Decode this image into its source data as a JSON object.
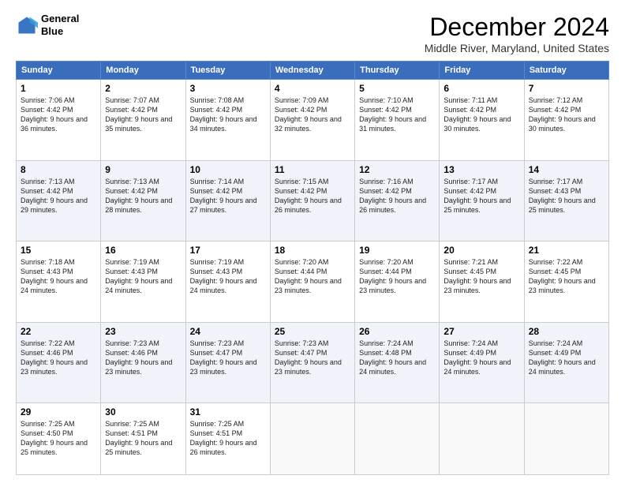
{
  "header": {
    "logo_line1": "General",
    "logo_line2": "Blue",
    "title": "December 2024",
    "subtitle": "Middle River, Maryland, United States"
  },
  "days_of_week": [
    "Sunday",
    "Monday",
    "Tuesday",
    "Wednesday",
    "Thursday",
    "Friday",
    "Saturday"
  ],
  "weeks": [
    [
      {
        "day": "1",
        "sunrise": "7:06 AM",
        "sunset": "4:42 PM",
        "daylight": "9 hours and 36 minutes."
      },
      {
        "day": "2",
        "sunrise": "7:07 AM",
        "sunset": "4:42 PM",
        "daylight": "9 hours and 35 minutes."
      },
      {
        "day": "3",
        "sunrise": "7:08 AM",
        "sunset": "4:42 PM",
        "daylight": "9 hours and 34 minutes."
      },
      {
        "day": "4",
        "sunrise": "7:09 AM",
        "sunset": "4:42 PM",
        "daylight": "9 hours and 32 minutes."
      },
      {
        "day": "5",
        "sunrise": "7:10 AM",
        "sunset": "4:42 PM",
        "daylight": "9 hours and 31 minutes."
      },
      {
        "day": "6",
        "sunrise": "7:11 AM",
        "sunset": "4:42 PM",
        "daylight": "9 hours and 30 minutes."
      },
      {
        "day": "7",
        "sunrise": "7:12 AM",
        "sunset": "4:42 PM",
        "daylight": "9 hours and 30 minutes."
      }
    ],
    [
      {
        "day": "8",
        "sunrise": "7:13 AM",
        "sunset": "4:42 PM",
        "daylight": "9 hours and 29 minutes."
      },
      {
        "day": "9",
        "sunrise": "7:13 AM",
        "sunset": "4:42 PM",
        "daylight": "9 hours and 28 minutes."
      },
      {
        "day": "10",
        "sunrise": "7:14 AM",
        "sunset": "4:42 PM",
        "daylight": "9 hours and 27 minutes."
      },
      {
        "day": "11",
        "sunrise": "7:15 AM",
        "sunset": "4:42 PM",
        "daylight": "9 hours and 26 minutes."
      },
      {
        "day": "12",
        "sunrise": "7:16 AM",
        "sunset": "4:42 PM",
        "daylight": "9 hours and 26 minutes."
      },
      {
        "day": "13",
        "sunrise": "7:17 AM",
        "sunset": "4:42 PM",
        "daylight": "9 hours and 25 minutes."
      },
      {
        "day": "14",
        "sunrise": "7:17 AM",
        "sunset": "4:43 PM",
        "daylight": "9 hours and 25 minutes."
      }
    ],
    [
      {
        "day": "15",
        "sunrise": "7:18 AM",
        "sunset": "4:43 PM",
        "daylight": "9 hours and 24 minutes."
      },
      {
        "day": "16",
        "sunrise": "7:19 AM",
        "sunset": "4:43 PM",
        "daylight": "9 hours and 24 minutes."
      },
      {
        "day": "17",
        "sunrise": "7:19 AM",
        "sunset": "4:43 PM",
        "daylight": "9 hours and 24 minutes."
      },
      {
        "day": "18",
        "sunrise": "7:20 AM",
        "sunset": "4:44 PM",
        "daylight": "9 hours and 23 minutes."
      },
      {
        "day": "19",
        "sunrise": "7:20 AM",
        "sunset": "4:44 PM",
        "daylight": "9 hours and 23 minutes."
      },
      {
        "day": "20",
        "sunrise": "7:21 AM",
        "sunset": "4:45 PM",
        "daylight": "9 hours and 23 minutes."
      },
      {
        "day": "21",
        "sunrise": "7:22 AM",
        "sunset": "4:45 PM",
        "daylight": "9 hours and 23 minutes."
      }
    ],
    [
      {
        "day": "22",
        "sunrise": "7:22 AM",
        "sunset": "4:46 PM",
        "daylight": "9 hours and 23 minutes."
      },
      {
        "day": "23",
        "sunrise": "7:23 AM",
        "sunset": "4:46 PM",
        "daylight": "9 hours and 23 minutes."
      },
      {
        "day": "24",
        "sunrise": "7:23 AM",
        "sunset": "4:47 PM",
        "daylight": "9 hours and 23 minutes."
      },
      {
        "day": "25",
        "sunrise": "7:23 AM",
        "sunset": "4:47 PM",
        "daylight": "9 hours and 23 minutes."
      },
      {
        "day": "26",
        "sunrise": "7:24 AM",
        "sunset": "4:48 PM",
        "daylight": "9 hours and 24 minutes."
      },
      {
        "day": "27",
        "sunrise": "7:24 AM",
        "sunset": "4:49 PM",
        "daylight": "9 hours and 24 minutes."
      },
      {
        "day": "28",
        "sunrise": "7:24 AM",
        "sunset": "4:49 PM",
        "daylight": "9 hours and 24 minutes."
      }
    ],
    [
      {
        "day": "29",
        "sunrise": "7:25 AM",
        "sunset": "4:50 PM",
        "daylight": "9 hours and 25 minutes."
      },
      {
        "day": "30",
        "sunrise": "7:25 AM",
        "sunset": "4:51 PM",
        "daylight": "9 hours and 25 minutes."
      },
      {
        "day": "31",
        "sunrise": "7:25 AM",
        "sunset": "4:51 PM",
        "daylight": "9 hours and 26 minutes."
      },
      null,
      null,
      null,
      null
    ]
  ],
  "labels": {
    "sunrise": "Sunrise:",
    "sunset": "Sunset:",
    "daylight": "Daylight:"
  }
}
